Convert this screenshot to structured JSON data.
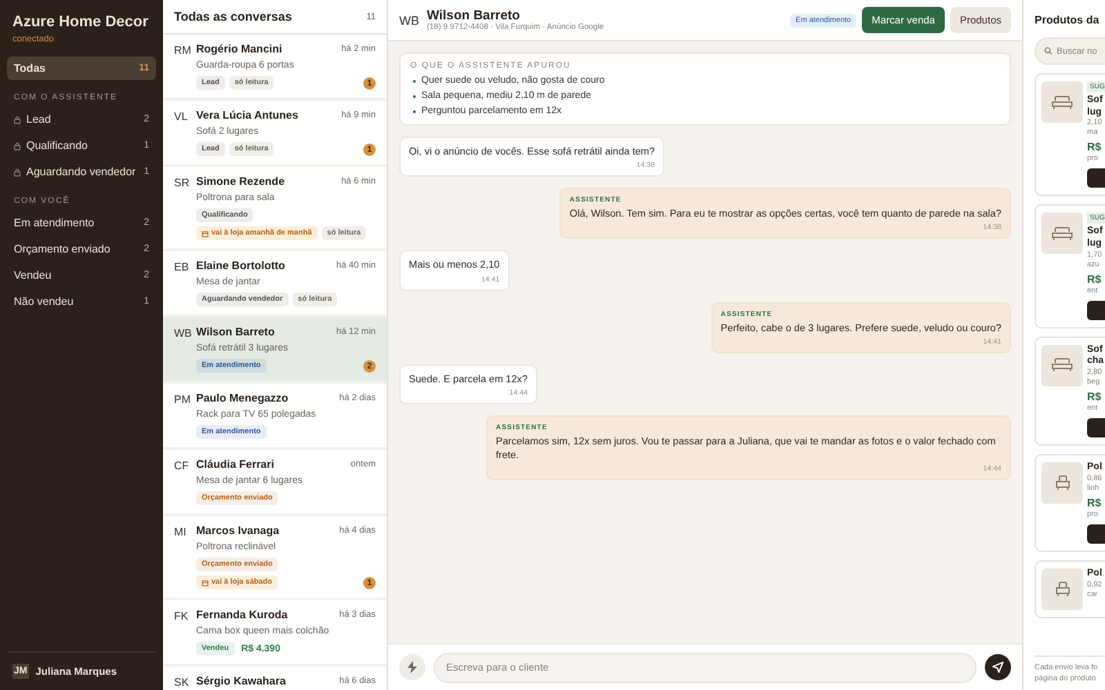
{
  "sidebar": {
    "brand": "Azure Home Decor",
    "status": "conectado",
    "top": {
      "label": "Todas",
      "count": "11",
      "selected": true
    },
    "sections": [
      {
        "title": "COM O ASSISTENTE",
        "items": [
          {
            "label": "Lead",
            "count": "2",
            "locked": true,
            "selected": false
          },
          {
            "label": "Qualificando",
            "count": "1",
            "locked": true,
            "selected": false
          },
          {
            "label": "Aguardando vendedor",
            "count": "1",
            "locked": true,
            "selected": false
          }
        ]
      },
      {
        "title": "COM VOCÊ",
        "items": [
          {
            "label": "Em atendimento",
            "count": "2",
            "locked": false,
            "selected": false
          },
          {
            "label": "Orçamento enviado",
            "count": "2",
            "locked": false,
            "selected": false
          },
          {
            "label": "Vendeu",
            "count": "2",
            "locked": false,
            "selected": false
          },
          {
            "label": "Não vendeu",
            "count": "1",
            "locked": false,
            "selected": false
          }
        ]
      }
    ],
    "user": {
      "initials": "JM",
      "name": "Juliana Marques"
    }
  },
  "conversations": {
    "title": "Todas as conversas",
    "count": "11",
    "items": [
      {
        "initials": "RM",
        "name": "Rogério Mancini",
        "time": "há 2 min",
        "subtitle": "Guarda-roupa 6 portas",
        "selected": false,
        "unread": "1",
        "tags": [
          {
            "kind": "status",
            "text": "Lead",
            "color": "#5a5148"
          },
          {
            "kind": "readonly",
            "text": "só leitura"
          }
        ]
      },
      {
        "initials": "VL",
        "name": "Vera Lúcia Antunes",
        "time": "há 9 min",
        "subtitle": "Sofá 2 lugares",
        "selected": false,
        "unread": "1",
        "tags": [
          {
            "kind": "status",
            "text": "Lead",
            "color": "#5a5148"
          },
          {
            "kind": "readonly",
            "text": "só leitura"
          }
        ]
      },
      {
        "initials": "SR",
        "name": "Simone Rezende",
        "time": "há 6 min",
        "subtitle": "Poltrona para sala",
        "selected": false,
        "tags": [
          {
            "kind": "status",
            "text": "Qualificando",
            "color": "#5a5148"
          },
          {
            "kind": "visit",
            "text": "vai à loja amanhã de manhã"
          },
          {
            "kind": "readonly",
            "text": "só leitura"
          }
        ]
      },
      {
        "initials": "EB",
        "name": "Elaine Bortolotto",
        "time": "há 40 min",
        "subtitle": "Mesa de jantar",
        "selected": false,
        "tags": [
          {
            "kind": "status",
            "text": "Aguardando vendedor",
            "color": "#5a5148"
          },
          {
            "kind": "readonly",
            "text": "só leitura"
          }
        ]
      },
      {
        "initials": "WB",
        "name": "Wilson Barreto",
        "time": "há 12 min",
        "subtitle": "Sofá retrátil 3 lugares",
        "selected": true,
        "unread": "2",
        "tags": [
          {
            "kind": "status",
            "text": "Em atendimento",
            "color": "#2f5aa0"
          }
        ]
      },
      {
        "initials": "PM",
        "name": "Paulo Menegazzo",
        "time": "há 2 dias",
        "subtitle": "Rack para TV 65 polegadas",
        "selected": false,
        "tags": [
          {
            "kind": "status",
            "text": "Em atendimento",
            "color": "#2f5aa0"
          }
        ]
      },
      {
        "initials": "CF",
        "name": "Cláudia Ferrari",
        "time": "ontem",
        "subtitle": "Mesa de jantar 6 lugares",
        "selected": false,
        "tags": [
          {
            "kind": "status",
            "text": "Orçamento enviado",
            "color": "#b0621c"
          }
        ]
      },
      {
        "initials": "MI",
        "name": "Marcos Ivanaga",
        "time": "há 4 dias",
        "subtitle": "Poltrona reclinável",
        "selected": false,
        "unread": "1",
        "tags": [
          {
            "kind": "status",
            "text": "Orçamento enviado",
            "color": "#b0621c"
          },
          {
            "kind": "visit",
            "text": "vai à loja sábado"
          }
        ]
      },
      {
        "initials": "FK",
        "name": "Fernanda Kuroda",
        "time": "há 3 dias",
        "subtitle": "Cama box queen mais colchão",
        "selected": false,
        "tags": [
          {
            "kind": "status",
            "text": "Vendeu",
            "color": "#2e7d4f"
          },
          {
            "kind": "price",
            "text": "R$ 4.390"
          }
        ]
      },
      {
        "initials": "SK",
        "name": "Sérgio Kawahara",
        "time": "há 6 dias",
        "selected": false
      }
    ]
  },
  "chat": {
    "initials": "WB",
    "name": "Wilson Barreto",
    "meta": "(18) 9 9712-4408 · Vila Furquim · Anúncio Google",
    "status": "Em atendimento",
    "buttons": [
      {
        "label": "Marcar venda",
        "kind": "primary"
      },
      {
        "label": "Produtos",
        "kind": "secondary"
      }
    ],
    "summary": {
      "title": "O QUE O ASSISTENTE APUROU",
      "items": [
        "Quer suede ou veludo, não gosta de couro",
        "Sala pequena, mediu 2,10 m de parede",
        "Perguntou parcelamento em 12x"
      ]
    },
    "messages": [
      {
        "kind": "customer",
        "text": "Oi, vi o anúncio de vocês. Esse sofá retrátil ainda tem?",
        "time": "14:38"
      },
      {
        "kind": "assistant",
        "label": "ASSISTENTE",
        "text": "Olá, Wilson. Tem sim. Para eu te mostrar as opções certas, você tem quanto de parede na sala?",
        "time": "14:38"
      },
      {
        "kind": "customer",
        "text": "Mais ou menos 2,10",
        "time": "14:41"
      },
      {
        "kind": "assistant",
        "label": "ASSISTENTE",
        "text": "Perfeito, cabe o de 3 lugares. Prefere suede, veludo ou couro?",
        "time": "14:41"
      },
      {
        "kind": "customer",
        "text": "Suede. E parcela em 12x?",
        "time": "14:44"
      },
      {
        "kind": "assistant",
        "label": "ASSISTENTE",
        "text": "Parcelamos sim, 12x sem juros. Vou te passar para a Juliana, que vai te mandar as fotos e o valor fechado com frete.",
        "time": "14:44"
      }
    ],
    "composer": {
      "placeholder": "Escreva para o cliente"
    }
  },
  "products": {
    "title": "Produtos da",
    "search_placeholder": "Buscar no",
    "items": [
      {
        "kind": "sofa",
        "tag": "SUG",
        "name": [
          "Sof",
          "lug"
        ],
        "details": [
          "2,10",
          "ma"
        ],
        "price": "R$",
        "note": "pro"
      },
      {
        "kind": "sofa",
        "tag": "SUG",
        "name": [
          "Sof",
          "lug"
        ],
        "details": [
          "1,70",
          "azu"
        ],
        "price": "R$",
        "note": "ent"
      },
      {
        "kind": "sofa",
        "name": [
          "Sof",
          "cha"
        ],
        "details": [
          "2,80",
          "beg"
        ],
        "price": "R$",
        "note": "ent"
      },
      {
        "kind": "armchair",
        "name": [
          "Pol"
        ],
        "details": [
          "0,86",
          "linh"
        ],
        "price": "R$",
        "note": "pro"
      },
      {
        "kind": "armchair",
        "name": [
          "Pol"
        ],
        "details": [
          "0,92",
          "car"
        ]
      }
    ],
    "footer": [
      "Cada envio leva fo",
      "página do produto"
    ]
  }
}
